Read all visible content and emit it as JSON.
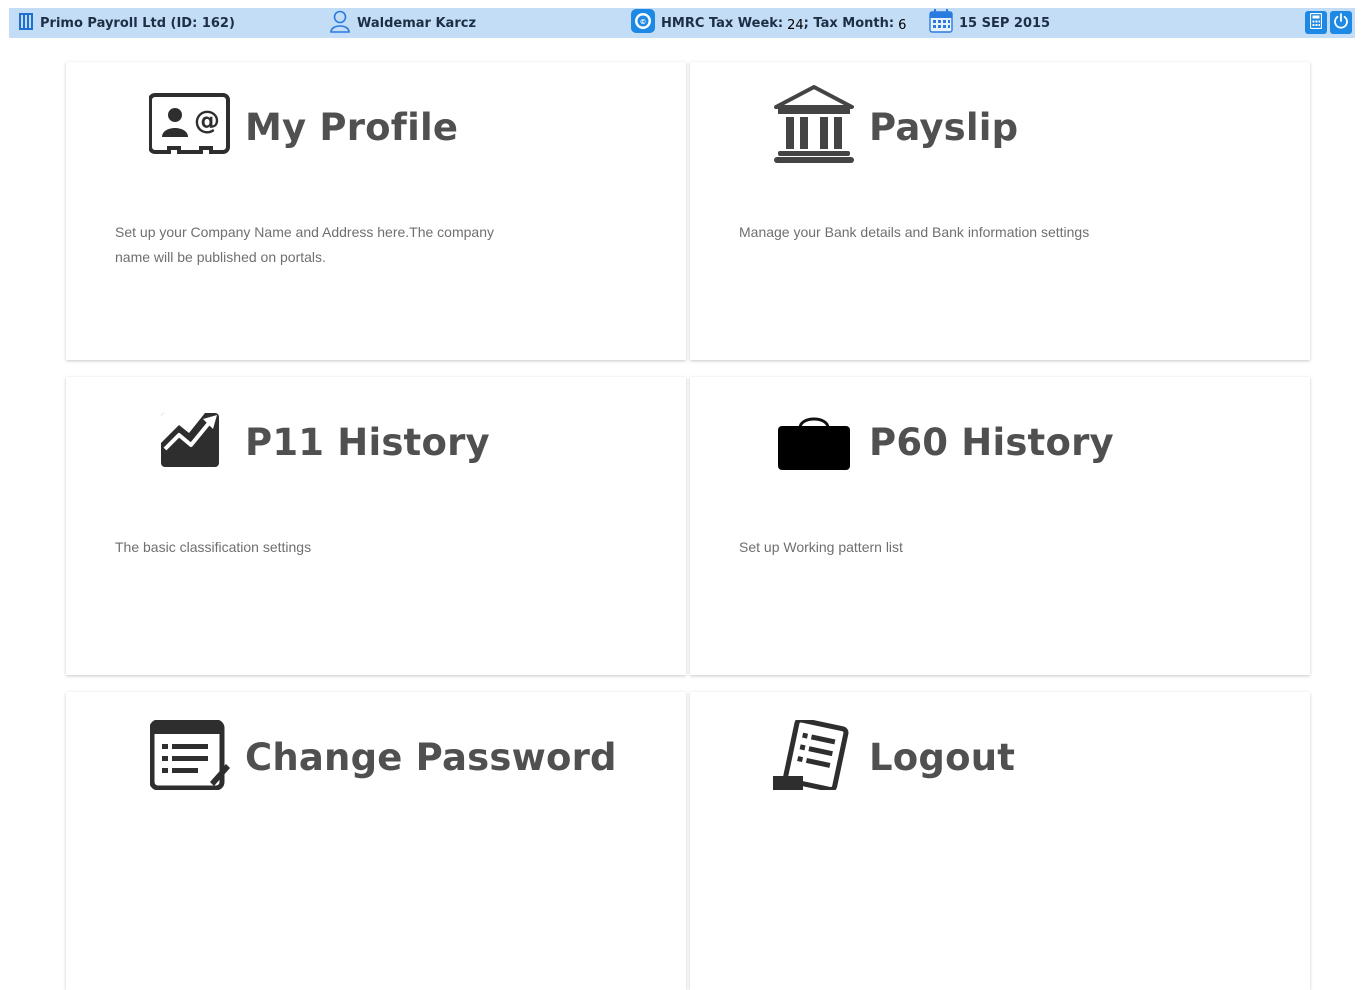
{
  "header": {
    "company": "Primo Payroll Ltd (ID: 162)",
    "user": "Waldemar Karcz",
    "hmrc_week_label": "HMRC Tax Week:",
    "hmrc_week_value": "24",
    "hmrc_month_label": "; Tax Month:",
    "hmrc_month_value": "6",
    "date": "15 SEP 2015",
    "icons": {
      "company": "building-icon",
      "user": "user-icon",
      "hmrc": "hmrc-icon",
      "date": "calendar-icon",
      "calculator": "calculator-icon",
      "power": "power-icon"
    }
  },
  "cards": [
    {
      "title": "My Profile",
      "description": "Set up your Company Name and Address here.The company name will be published on portals.",
      "icon": "contact-card-icon"
    },
    {
      "title": "Payslip",
      "description": "Manage your Bank details and Bank information settings",
      "icon": "bank-icon"
    },
    {
      "title": "P11 History",
      "description": "The basic classification settings",
      "icon": "trend-chart-icon"
    },
    {
      "title": "P60 History",
      "description": "Set up Working pattern list",
      "icon": "briefcase-icon"
    },
    {
      "title": "Change Password",
      "description": "",
      "icon": "form-edit-icon"
    },
    {
      "title": "Logout",
      "description": "",
      "icon": "document-list-icon"
    }
  ],
  "colors": {
    "topbar_bg": "#c4ddf6",
    "accent_button": "#1e88e5",
    "title_text": "#505050",
    "desc_text": "#6f6f6f"
  }
}
